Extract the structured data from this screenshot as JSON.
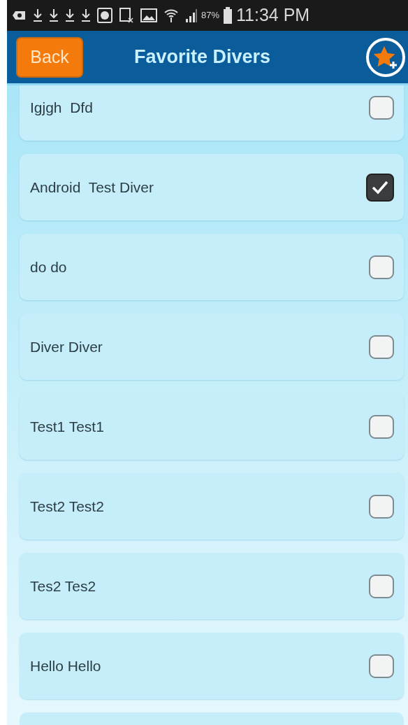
{
  "status_bar": {
    "battery": "87%",
    "time": "11:34 PM"
  },
  "header": {
    "back_button": "Back",
    "title": "Favorite Divers"
  },
  "divers": [
    {
      "name": "Igjgh  Dfd",
      "checked": false
    },
    {
      "name": "Android  Test Diver",
      "checked": true
    },
    {
      "name": "do do",
      "checked": false
    },
    {
      "name": "Diver Diver",
      "checked": false
    },
    {
      "name": "Test1 Test1",
      "checked": false
    },
    {
      "name": "Test2 Test2",
      "checked": false
    },
    {
      "name": "Tes2 Tes2",
      "checked": false
    },
    {
      "name": "Hello Hello",
      "checked": false
    }
  ]
}
